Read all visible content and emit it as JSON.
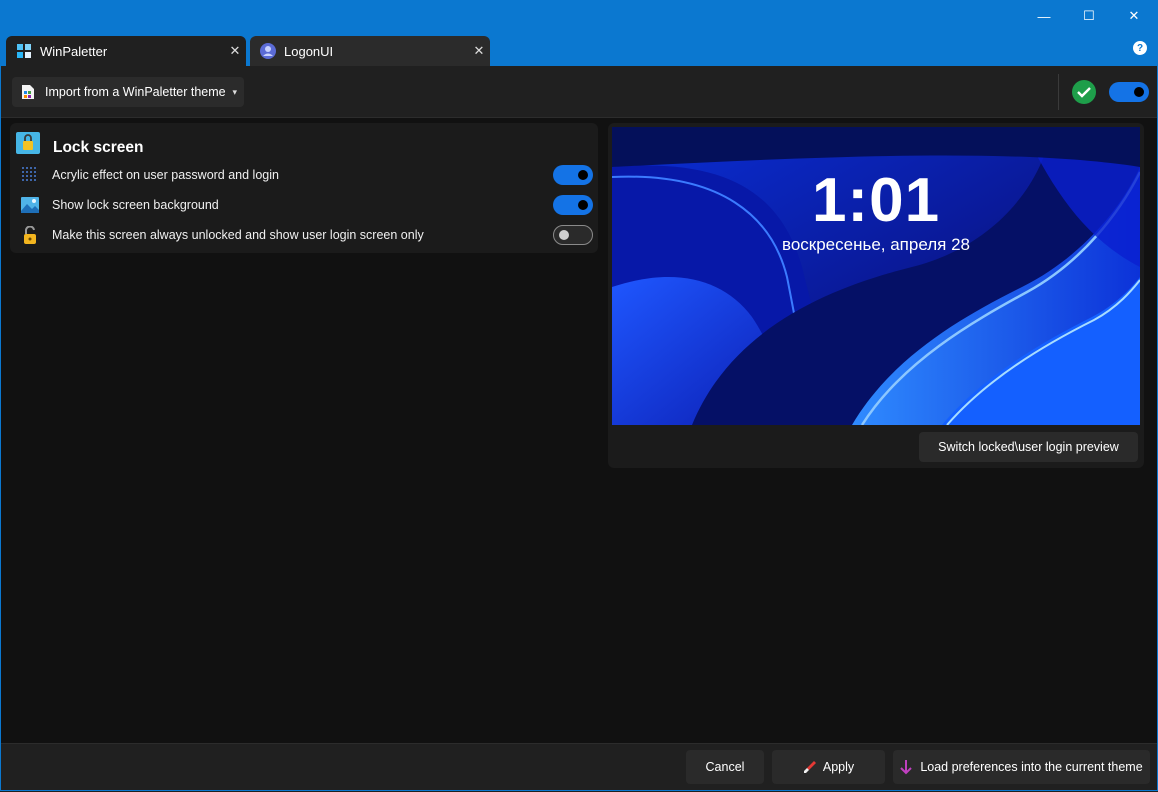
{
  "window": {
    "minimize_glyph": "—",
    "maximize_glyph": "☐",
    "close_glyph": "✕",
    "help_glyph": "?"
  },
  "tabs": [
    {
      "label": "WinPaletter",
      "icon": "winpaletter-icon",
      "active": true
    },
    {
      "label": "LogonUI",
      "icon": "user-icon",
      "active": false
    }
  ],
  "tab_close_glyph": "✕",
  "toolbar": {
    "import_label": "Import from a WinPaletter theme",
    "import_dropdown_glyph": "▾",
    "status_icon": "check-icon",
    "enabled": true
  },
  "lock_screen": {
    "title": "Lock screen",
    "options": [
      {
        "label": "Acrylic effect on user password and login",
        "icon": "acrylic-dots-icon",
        "enabled": true
      },
      {
        "label": "Show lock screen background",
        "icon": "image-icon",
        "enabled": true
      },
      {
        "label": "Make this screen always unlocked and show user login screen only",
        "icon": "unlocked-padlock-icon",
        "enabled": false
      }
    ]
  },
  "preview": {
    "time": "1:01",
    "date": "воскресенье, апреля 28",
    "switch_button": "Switch locked\\user login preview"
  },
  "footer": {
    "cancel": "Cancel",
    "apply": "Apply",
    "load": "Load preferences into the current theme"
  },
  "colors": {
    "accent": "#0b78d0",
    "toggle_on": "#1473e6",
    "success": "#1e9e4a",
    "load_arrow": "#c040c0"
  }
}
